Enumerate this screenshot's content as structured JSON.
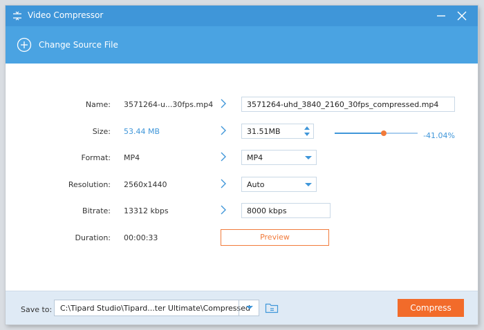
{
  "window": {
    "title": "Video Compressor"
  },
  "toolbar": {
    "change_source_label": "Change Source File"
  },
  "rows": {
    "name": {
      "label": "Name:",
      "original": "3571264-u...30fps.mp4",
      "output": "3571264-uhd_3840_2160_30fps_compressed.mp4"
    },
    "size": {
      "label": "Size:",
      "original": "53.44 MB",
      "output": "31.51MB",
      "percent": "-41.04%",
      "slider_fraction": 0.5896
    },
    "format": {
      "label": "Format:",
      "original": "MP4",
      "output": "MP4"
    },
    "resolution": {
      "label": "Resolution:",
      "original": "2560x1440",
      "output": "Auto"
    },
    "bitrate": {
      "label": "Bitrate:",
      "original": "13312 kbps",
      "output": "8000 kbps"
    },
    "duration": {
      "label": "Duration:",
      "original": "00:00:33"
    }
  },
  "preview_label": "Preview",
  "footer": {
    "save_to_label": "Save to:",
    "path": "C:\\Tipard Studio\\Tipard...ter Ultimate\\Compressed",
    "compress_label": "Compress"
  },
  "colors": {
    "title_bar": "#3f96d9",
    "toolbar": "#4aa3e2",
    "accent": "#3f96d9",
    "orange": "#f26b2a"
  },
  "icons": [
    "compressor-icon",
    "minimize-icon",
    "close-icon",
    "plus-circle-icon",
    "chevron-right-icon",
    "spin-up-icon",
    "spin-down-icon",
    "dropdown-arrow-icon",
    "folder-icon"
  ]
}
